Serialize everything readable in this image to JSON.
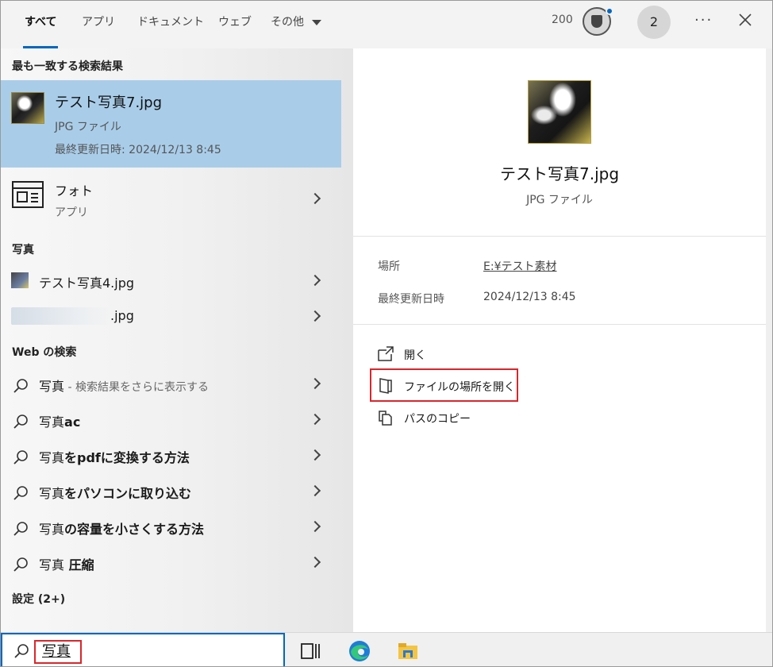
{
  "tabs": [
    {
      "label": "すべて",
      "active": true
    },
    {
      "label": "アプリ"
    },
    {
      "label": "ドキュメント"
    },
    {
      "label": "ウェブ"
    },
    {
      "label": "その他"
    }
  ],
  "header": {
    "points": "200",
    "reward_icon": "trophy-icon",
    "avatar_text": "2",
    "more_label": "···",
    "close_icon": "close-icon"
  },
  "results": {
    "best_match_title": "最も一致する検索結果",
    "best_match": {
      "name": "テスト写真7.jpg",
      "type": "JPG ファイル",
      "modified": "最終更新日時: 2024/12/13 8:45"
    },
    "app": {
      "name": "フォト",
      "type": "アプリ"
    },
    "photos_title": "写真",
    "photos": [
      {
        "name": "テスト写真4.jpg"
      },
      {
        "name": ".jpg"
      }
    ],
    "web_title": "Web の検索",
    "web": [
      {
        "prefix": "写真",
        "bold": "",
        "hint": " - 検索結果をさらに表示する"
      },
      {
        "prefix": "写真",
        "bold": "ac",
        "hint": ""
      },
      {
        "prefix": "写真",
        "bold": "をpdfに変換する方法",
        "hint": ""
      },
      {
        "prefix": "写真",
        "bold": "をパソコンに取り込む",
        "hint": ""
      },
      {
        "prefix": "写真",
        "bold": "の容量を小さくする方法",
        "hint": ""
      },
      {
        "prefix": "写真",
        "bold": " 圧縮",
        "hint": ""
      }
    ],
    "settings_title": "設定 (2+)"
  },
  "preview": {
    "name": "テスト写真7.jpg",
    "type": "JPG ファイル",
    "location_key": "場所",
    "location_val": "E:¥テスト素材",
    "modified_key": "最終更新日時",
    "modified_val": "2024/12/13 8:45",
    "actions": [
      {
        "label": "開く",
        "icon": "open-icon"
      },
      {
        "label": "ファイルの場所を開く",
        "icon": "folder-location-icon"
      },
      {
        "label": "パスのコピー",
        "icon": "copy-icon"
      }
    ]
  },
  "search": {
    "value": "写真"
  },
  "taskbar": {
    "icons": [
      "task-view-icon",
      "edge-icon",
      "file-explorer-icon"
    ]
  },
  "colors": {
    "accent": "#0067c0",
    "selection": "#a9cde9",
    "highlight": "#d9262c"
  }
}
